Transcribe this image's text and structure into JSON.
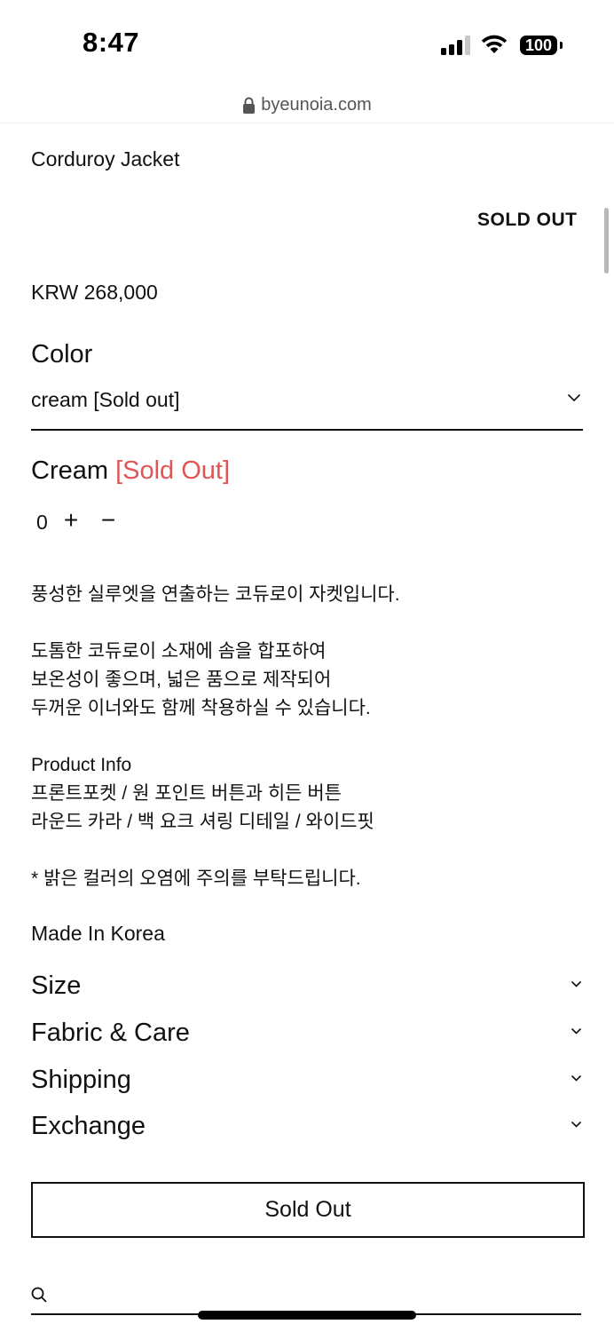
{
  "status_bar": {
    "time": "8:47",
    "battery": "100"
  },
  "browser": {
    "url": "byeunoia.com"
  },
  "product": {
    "title": "Corduroy Jacket",
    "status_tag": "SOLD OUT",
    "price": "KRW 268,000",
    "color_label": "Color",
    "color_selected": "cream [Sold out]",
    "variant_name": "Cream",
    "variant_status": "[Sold Out]",
    "quantity": "0",
    "plus": "+",
    "minus": "−"
  },
  "description": {
    "line1": "풍성한 실루엣을 연출하는 코듀로이 자켓입니다.",
    "line2": "도톰한 코듀로이 소재에 솜을 합포하여",
    "line3": "보온성이 좋으며, 넓은 품으로 제작되어",
    "line4": "두꺼운 이너와도 함께 착용하실 수 있습니다.",
    "line5": "Product Info",
    "line6": "프론트포켓 / 원 포인트 버튼과 히든 버튼",
    "line7": "라운드 카라 / 백 요크 셔링 디테일 / 와이드핏",
    "line8": "* 밝은 컬러의 오염에 주의를 부탁드립니다."
  },
  "origin": "Made In Korea",
  "accordions": [
    {
      "label": "Size"
    },
    {
      "label": "Fabric & Care"
    },
    {
      "label": "Shipping"
    },
    {
      "label": "Exchange"
    }
  ],
  "buy_button": "Sold Out",
  "colors": {
    "sold_out_red": "#e05555",
    "text": "#111111"
  }
}
